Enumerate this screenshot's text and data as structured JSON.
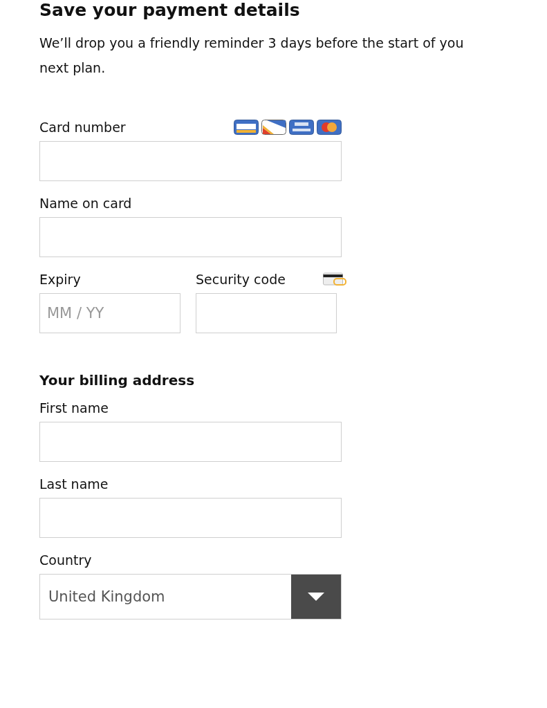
{
  "heading": "Save your payment details",
  "intro_lines": [
    "We’ll drop you a friendly reminder 3 days before the start of you",
    "next plan."
  ],
  "card_number": {
    "label": "Card number"
  },
  "name_on_card": {
    "label": "Name on card"
  },
  "expiry": {
    "label": "Expiry",
    "placeholder": "MM / YY"
  },
  "security_code": {
    "label": "Security code"
  },
  "billing_heading": "Your billing address",
  "first_name": {
    "label": "First name"
  },
  "last_name": {
    "label": "Last name"
  },
  "country": {
    "label": "Country",
    "value": "United Kingdom"
  }
}
